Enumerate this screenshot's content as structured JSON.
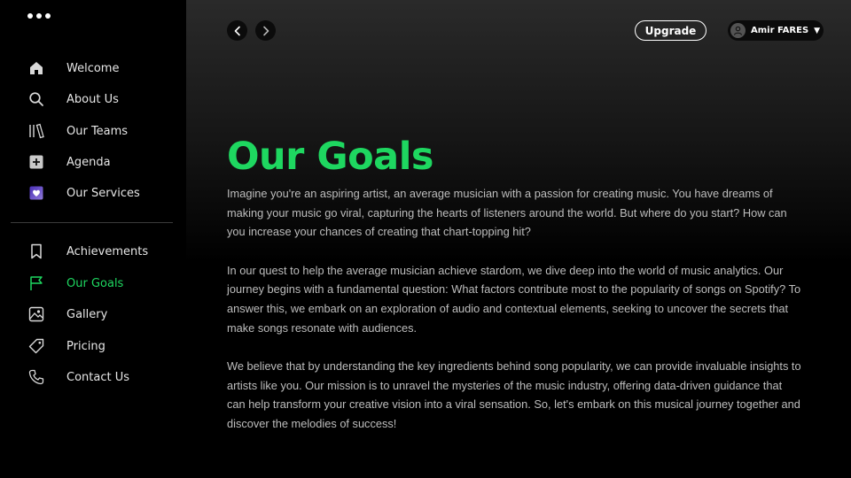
{
  "sidebar": {
    "items_top": [
      {
        "label": "Welcome",
        "icon": "home-icon"
      },
      {
        "label": "About Us",
        "icon": "search-icon"
      },
      {
        "label": "Our  Teams",
        "icon": "library-icon"
      },
      {
        "label": "Agenda",
        "icon": "plus-square-icon"
      },
      {
        "label": "Our Services",
        "icon": "heart-square-icon"
      }
    ],
    "items_bottom": [
      {
        "label": "Achievements",
        "icon": "bookmark-icon"
      },
      {
        "label": "Our Goals",
        "icon": "flag-icon",
        "active": true
      },
      {
        "label": "Gallery",
        "icon": "image-icon"
      },
      {
        "label": "Pricing",
        "icon": "tag-icon"
      },
      {
        "label": "Contact Us",
        "icon": "phone-icon"
      }
    ]
  },
  "header": {
    "upgrade_label": "Upgrade",
    "user_name": "Amir FARES"
  },
  "main": {
    "title": "Our Goals",
    "paragraphs": [
      "Imagine you're an aspiring artist, an average musician with a passion for creating music. You have dreams of making your music go viral, capturing the hearts of listeners around the world. But where do you start? How can you increase your chances of creating that chart-topping hit?",
      "In our quest to help the average musician achieve stardom, we dive deep into the world of music analytics. Our journey begins with a fundamental question: What factors contribute most to the popularity of songs on Spotify? To answer this, we embark on an exploration of audio and contextual elements, seeking to uncover the secrets that make songs resonate with audiences.",
      "We believe that by understanding the key ingredients behind song popularity, we can provide invaluable insights to artists like you. Our mission is to unravel the mysteries of the music industry, offering data-driven guidance that can help transform your creative vision into a viral sensation. So, let's embark on this musical journey together and discover the melodies of success!"
    ]
  },
  "colors": {
    "accent": "#1ed760",
    "background": "#000000",
    "services_icon": "#6a4fc9"
  }
}
